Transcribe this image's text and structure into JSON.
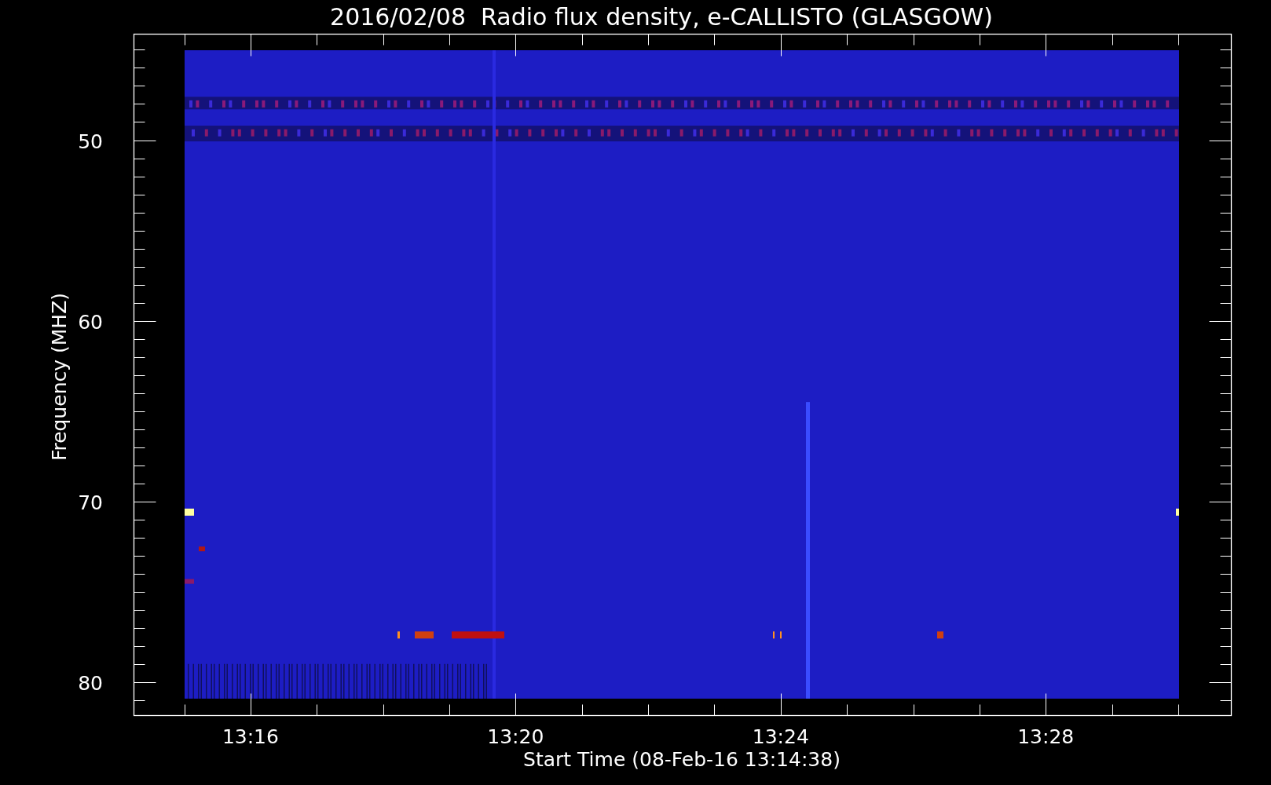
{
  "title": "2016/02/08  Radio flux density, e-CALLISTO (GLASGOW)",
  "y_axis": {
    "label": "Frequency (MHZ)",
    "ticks": [
      "50",
      "60",
      "70",
      "80"
    ]
  },
  "x_axis": {
    "label": "Start Time (08-Feb-16 13:14:38)",
    "ticks": [
      "13:16",
      "13:20",
      "13:24",
      "13:28"
    ]
  }
}
